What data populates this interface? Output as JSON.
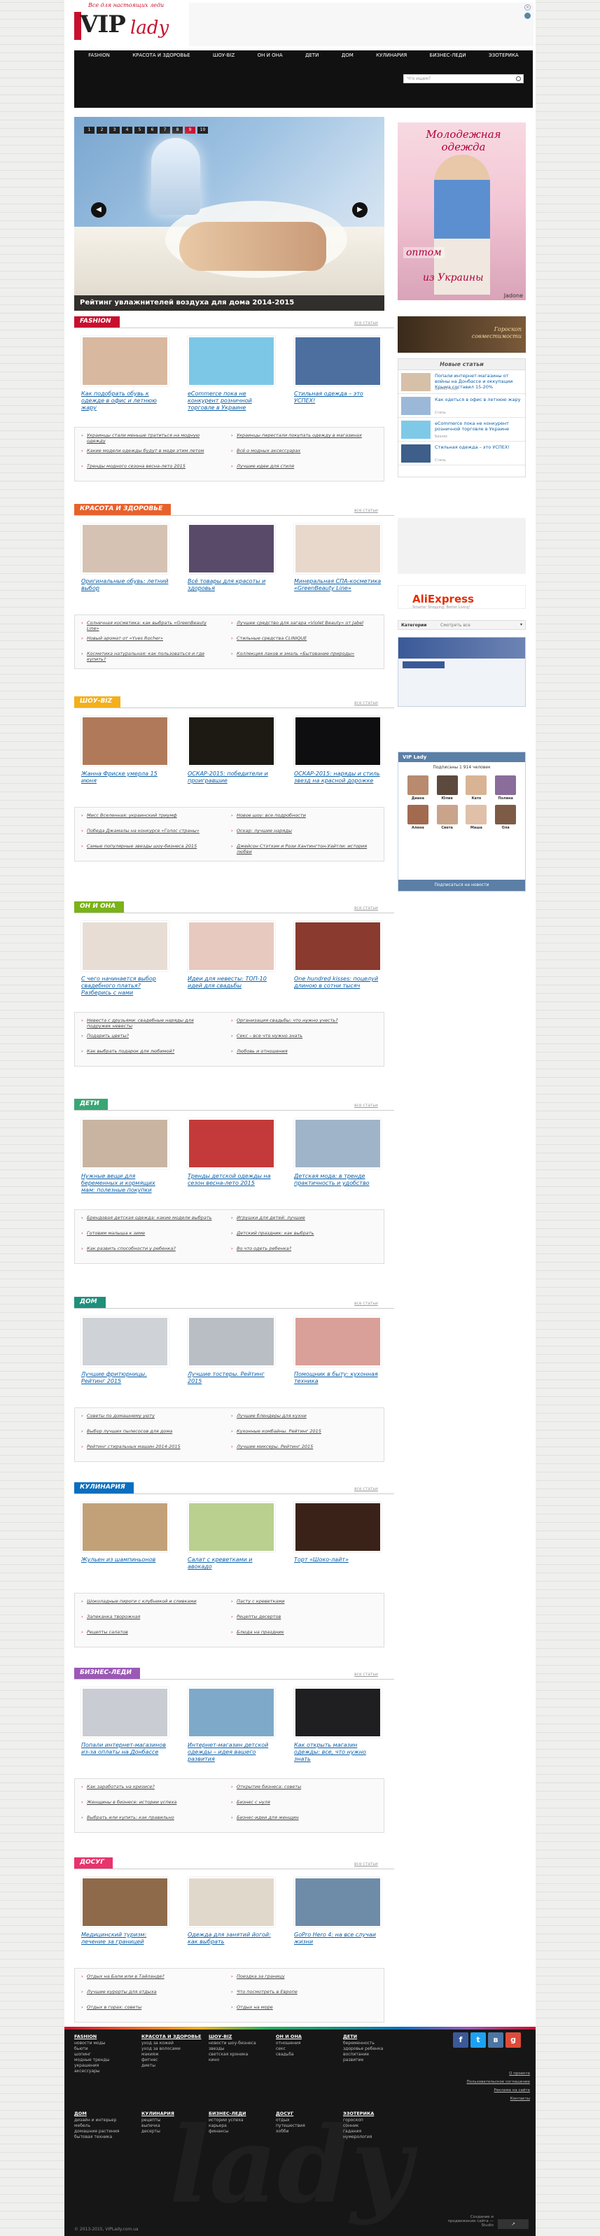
{
  "site": {
    "tagline": "Все для настоящих леди",
    "logo_vip": "VIP",
    "logo_lady": "lady"
  },
  "ad_top": {
    "close": "×"
  },
  "nav": [
    "FASHION",
    "КРАСОТА И ЗДОРОВЬЕ",
    "ШОУ-BIZ",
    "ОН И ОНА",
    "ДЕТИ",
    "ДОМ",
    "КУЛИНАРИЯ",
    "БИЗНЕС-ЛЕДИ",
    "ЭЗОТЕРИКА"
  ],
  "search": {
    "placeholder": "Что ищем?"
  },
  "slider": {
    "pages": [
      "1",
      "2",
      "3",
      "4",
      "5",
      "6",
      "7",
      "8",
      "9",
      "10"
    ],
    "active_page": 9,
    "caption": "Рейтинг увлажнителей воздуха для дома 2014-2015"
  },
  "side_ad": {
    "headline": "Молодежная одежда",
    "line1": "оптом",
    "line2": "из Украины",
    "brand": "Jadone"
  },
  "all_link": "все статьи",
  "sections": [
    {
      "title": "FASHION",
      "color": "#c8102e",
      "cards": [
        "Как подобрать обувь к одежде в офис и летнюю жару",
        "eCommerce пока не конкурент розничной торговле в Украине",
        "Стильная одежда – это УСПЕХ!"
      ],
      "links": [
        "Украинцы стали меньше тратиться на модную одежду",
        "Какие модели одежды будут в моде этим летом",
        "Тренды модного сезона весна-лето 2015",
        "Украинцы перестали покупать одежду в магазинах",
        "Всё о модных аксессуарах",
        "Лучшие идеи для стиля"
      ]
    },
    {
      "title": "КРАСОТА И ЗДОРОВЬЕ",
      "color": "#e8612c",
      "cards": [
        "Оригинальные обувь: летний выбор",
        "Всё товары для красоты и здоровья",
        "Минеральная СПА-косметика «GreenBeauty Line»"
      ],
      "links": [
        "Солнечная косметика: как выбрать «GreenBeauty Line»",
        "Новый аромат от «Yves Rocher»",
        "Косметика натуральная: как пользоваться и где купить?",
        "Лучшее средство для загара «Violet Beauty» от Jabel",
        "Стильные средства CLINIQUE",
        "Коллекция лаков и эмаль «Бытование природы»"
      ]
    },
    {
      "title": "ШОУ-BIZ",
      "color": "#f3b01c",
      "cards": [
        "Жанна Фриске умерла 15 июня",
        "ОСКАР-2015: победители и проигравшие",
        "ОСКАР-2015: наряды и стиль звезд на красной дорожке"
      ],
      "links": [
        "Мисс Вселенная: украинский триумф",
        "Победа Джамалы на конкурсе «Голос страны»",
        "Самые популярные звезды шоу-бизнеса 2015",
        "Новое шоу: все подробности",
        "Оскар: лучшие наряды",
        "Джейсон Стэтхэм и Рози Хантингтон-Уайтли: история любви"
      ]
    },
    {
      "title": "ОН И ОНА",
      "color": "#7ab317",
      "cards": [
        "С чего начинается выбор свадебного платья? Разберись с нами",
        "Идеи для невесты: ТОП-10 идей для свадьбы",
        "One hundred kisses: поцелуй длиною в сотни тысяч"
      ],
      "links": [
        "Невеста с друзьями: свадебные наряды для подружек невесты",
        "Подарить цветы?",
        "Как выбрать подарок для любимой?",
        "Организация свадьбы: что нужно учесть?",
        "Секс – все что нужно знать",
        "Любовь и отношения"
      ]
    },
    {
      "title": "ДЕТИ",
      "color": "#3aa675",
      "cards": [
        "Нужные вещи для беременных и кормящих мам: полезные покупки",
        "Тренды детской одежды на сезон весна-лето 2015",
        "Детская мода: в тренде практичность и удобство"
      ],
      "links": [
        "Брендовая детская одежда: какие модели выбрать",
        "Готовим малыша к зиме",
        "Как развить способности у ребенка?",
        "Игрушки для детей: лучшие",
        "Детский праздник: как выбрать",
        "Во что одеть ребенка?"
      ]
    },
    {
      "title": "ДОМ",
      "color": "#1f8f7c",
      "cards": [
        "Лучшие фритюрницы. Рейтинг 2015",
        "Лучшие тостеры. Рейтинг 2015",
        "Помощник в быту: кухонная техника"
      ],
      "links": [
        "Советы по домашнему уюту",
        "Выбор лучших пылесосов для дома",
        "Рейтинг стиральных машин 2014-2015",
        "Лучшие блендеры для кухни",
        "Кухонные комбайны. Рейтинг 2015",
        "Лучшие миксеры. Рейтинг 2015"
      ]
    },
    {
      "title": "КУЛИНАРИЯ",
      "color": "#0a6fbe",
      "cards": [
        "Жульен из шампиньонов",
        "Салат с креветками и авокадо",
        "Торт «Шоко-лайт»"
      ],
      "links": [
        "Шоколадные пироги с клубникой и сливками",
        "Запеканка творожная",
        "Рецепты салатов",
        "Пасту с креветками",
        "Рецепты десертов",
        "Блюда на праздник"
      ]
    },
    {
      "title": "БИЗНЕС-ЛЕДИ",
      "color": "#9b59b6",
      "cards": [
        "Попали интернет-магазинов из-за оплаты на Донбассе",
        "Интернет-магазин детской одежды – идея вашего развития",
        "Как открыть магазин одежды: все, что нужно знать"
      ],
      "links": [
        "Как заработать на кризисе?",
        "Женщины в бизнесе: истории успеха",
        "Выбрать или купить: как правильно",
        "Открытие бизнеса: советы",
        "Бизнес с нуля",
        "Бизнес-идеи для женщин"
      ]
    },
    {
      "title": "ДОСУГ",
      "color": "#e8336d",
      "cards": [
        "Медицинский туризм: лечение за границей",
        "Одежда для занятий йогой: как выбрать",
        "GoPro Hero 4: на все случаи жизни"
      ],
      "links": [
        "Отдых на Бали или в Тайланде?",
        "Лучшие курорты для отдыха",
        "Отдых в горах: советы",
        "Поездка за границу",
        "Что посмотреть в Европе",
        "Отдых на море"
      ]
    }
  ],
  "right": {
    "horoscope": "Гороскоп совместимости",
    "new_title": "Новые статьи",
    "new_items": [
      {
        "t": "Попали интернет-магазины от войны на Донбассе и оккупации Крыма составил 15-20%",
        "s": "Бизнес-леди"
      },
      {
        "t": "Как одеться в офис в летнюю жару",
        "s": "Стиль"
      },
      {
        "t": "eCommerce пока не конкурент розничной торговле в Украине",
        "s": "Бизнес"
      },
      {
        "t": "Стильная одежда – это УСПЕХ!",
        "s": "Стиль"
      }
    ],
    "ali": {
      "title": "AliExpress",
      "sub": "Smarter Shopping. Better Living!"
    },
    "cats": {
      "label": "Категории",
      "placeholder": "Смотреть все"
    },
    "vk": {
      "title": "VIP Lady",
      "subs": "Подписаны 1 914 человек",
      "button": "Подписаться на новости",
      "members": [
        "Диана",
        "Юлия",
        "Катя",
        "Полина",
        "Алена",
        "Света",
        "Маша",
        "Оля"
      ]
    }
  },
  "footer": {
    "cols": [
      {
        "h": "FASHION",
        "items": [
          "новости моды",
          "бьюти",
          "шопинг",
          "модные тренды",
          "украшения",
          "аксессуары"
        ]
      },
      {
        "h": "КРАСОТА И ЗДОРОВЬЕ",
        "items": [
          "уход за кожей",
          "уход за волосами",
          "макияж",
          "фитнес",
          "диеты"
        ]
      },
      {
        "h": "ШОУ-BIZ",
        "items": [
          "новости шоу-бизнеса",
          "звезды",
          "светская хроника",
          "кино"
        ]
      },
      {
        "h": "ОН И ОНА",
        "items": [
          "отношения",
          "секс",
          "свадьба"
        ]
      },
      {
        "h": "ДЕТИ",
        "items": [
          "беременность",
          "здоровье ребенка",
          "воспитание",
          "развитие"
        ]
      },
      {
        "h": "ДОМ",
        "items": [
          "дизайн и интерьер",
          "мебель",
          "домашние растения",
          "бытовая техника"
        ]
      },
      {
        "h": "КУЛИНАРИЯ",
        "items": [
          "рецепты",
          "выпечка",
          "десерты"
        ]
      },
      {
        "h": "БИЗНЕС-ЛЕДИ",
        "items": [
          "истории успеха",
          "карьера",
          "финансы"
        ]
      },
      {
        "h": "ДОСУГ",
        "items": [
          "отдых",
          "путешествия",
          "хобби"
        ]
      },
      {
        "h": "ЭЗОТЕРИКА",
        "items": [
          "гороскоп",
          "сонник",
          "гадания",
          "нумерология"
        ]
      }
    ],
    "right_links": [
      "О проекте",
      "Пользовательское соглашение",
      "Реклама на сайте",
      "Контакты"
    ],
    "copyright": "© 2013-2015, VIPLady.com.ua",
    "dev": "Создание и продвижение сайта — Studio"
  }
}
